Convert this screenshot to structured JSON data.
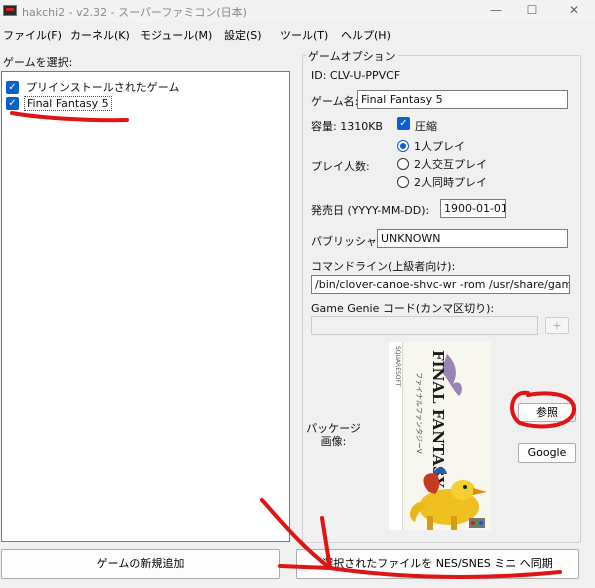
{
  "window": {
    "title": "hakchi2 - v2.32 - スーパーファミコン(日本)",
    "minimize": "—",
    "maximize": "☐",
    "close": "✕"
  },
  "menu": {
    "items": [
      "ファイル(F)",
      "カーネル(K)",
      "モジュール(M)",
      "設定(S)",
      "ツール(T)",
      "ヘルプ(H)"
    ]
  },
  "left": {
    "label": "ゲームを選択:",
    "games": [
      {
        "label": "プリインストールされたゲーム",
        "checked": true
      },
      {
        "label": "Final Fantasy 5",
        "checked": true
      }
    ],
    "add_button": "ゲームの新規追加"
  },
  "options": {
    "legend": "ゲームオプション",
    "id_text": "ID: CLV-U-PPVCF",
    "name_label": "ゲーム名:",
    "name_value": "Final Fantasy 5",
    "size_label": "容量: 1310KB",
    "compress_label": "圧縮",
    "compress_checked": true,
    "players_label": "プレイ人数:",
    "players_options": [
      {
        "label": "1人プレイ",
        "selected": true
      },
      {
        "label": "2人交互プレイ",
        "selected": false
      },
      {
        "label": "2人同時プレイ",
        "selected": false
      }
    ],
    "release_label": "発売日 (YYYY-MM-DD):",
    "release_value": "1900-01-01",
    "publisher_label": "パブリッシャー:",
    "publisher_value": "UNKNOWN",
    "cmdline_label": "コマンドライン(上級者向け):",
    "cmdline_value": "/bin/clover-canoe-shvc-wr -rom /usr/share/games",
    "genie_label": "Game Genie コード(カンマ区切り):",
    "genie_value": "",
    "genie_add": "+",
    "package_label": "パッケージ画像:",
    "browse_button": "参照",
    "google_button": "Google",
    "cover": {
      "logo_text": "FINAL FANTASY V",
      "kana_text": "ファイナルファンタジーV",
      "publisher_mark": "SQUARESOFT"
    }
  },
  "sync_button": "選択されたファイルを NES/SNES ミニ へ同期",
  "colors": {
    "accent": "#0b5fca",
    "annotation": "#e01414"
  }
}
